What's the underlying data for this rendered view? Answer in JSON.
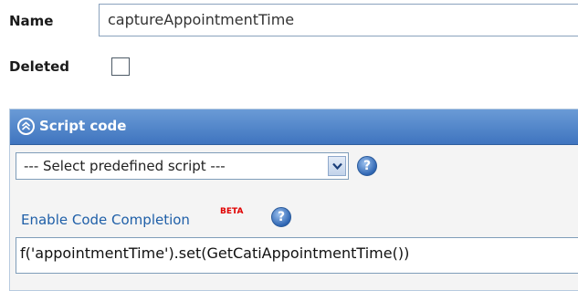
{
  "form": {
    "name_label": "Name",
    "name_value": "captureAppointmentTime",
    "deleted_label": "Deleted",
    "deleted_checked": false
  },
  "script_panel": {
    "title": "Script code",
    "collapse_icon": "double-chevron-up-icon",
    "predefined_select_value": "--- Select predefined script ---",
    "help_icon": "question-mark-icon",
    "code_completion_label": "Enable Code Completion",
    "beta_badge": "BETA",
    "code": "f('appointmentTime').set(GetCatiAppointmentTime())"
  },
  "colors": {
    "panel_header": "#4a7fc6",
    "link": "#1f5fa8",
    "beta": "#e00000"
  }
}
